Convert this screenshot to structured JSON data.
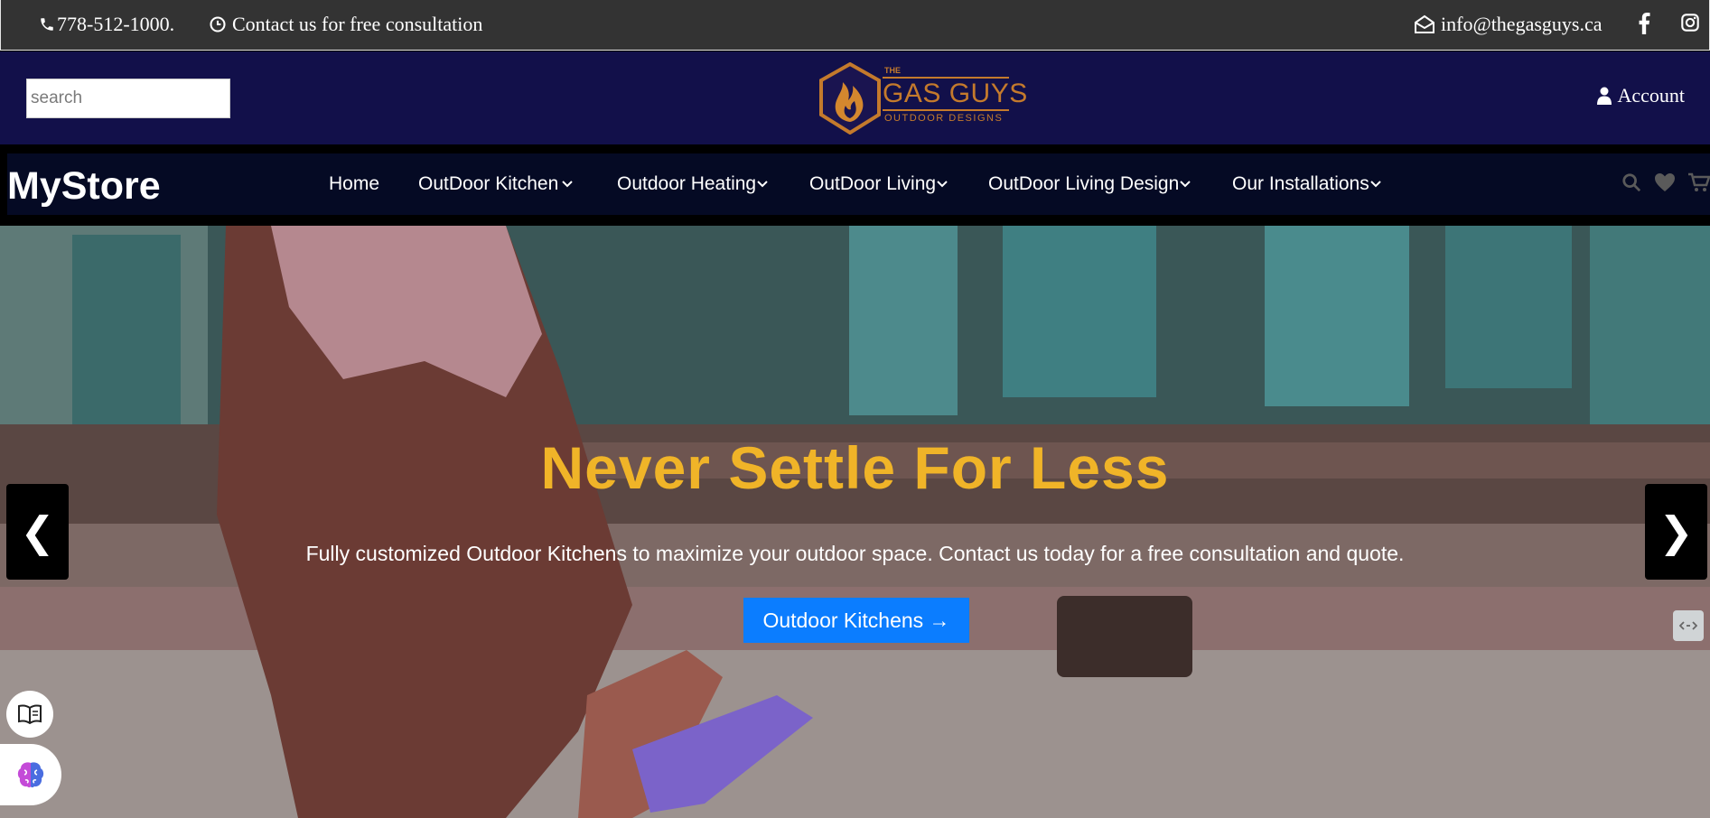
{
  "topbar": {
    "phone": "778-512-1000.",
    "consultation": "Contact us for free consultation",
    "email": "info@thegasguys.ca"
  },
  "header": {
    "search_placeholder": "search",
    "logo": {
      "top": "THE",
      "name": "GAS GUYS",
      "tagline": "OUTDOOR DESIGNS"
    },
    "account_label": "Account"
  },
  "nav": {
    "brand": "MyStore",
    "items": [
      {
        "label": "Home"
      },
      {
        "label": "OutDoor Kitchen"
      },
      {
        "label": "Outdoor Heating"
      },
      {
        "label": "OutDoor Living"
      },
      {
        "label": "OutDoor Living Design"
      },
      {
        "label": "Our Installations"
      }
    ]
  },
  "hero": {
    "title": "Never Settle For Less",
    "subtitle": "Fully customized Outdoor Kitchens to maximize your outdoor space. Contact us today for a free consultation and quote.",
    "cta_label": "Outdoor Kitchens →",
    "prev_label": "❮",
    "next_label": "❯"
  },
  "colors": {
    "topbar_bg": "#333333",
    "header_bg": "#12104a",
    "nav_bg": "#050a24",
    "title_gold": "#f0b428",
    "cta_blue": "#0b7dff"
  }
}
